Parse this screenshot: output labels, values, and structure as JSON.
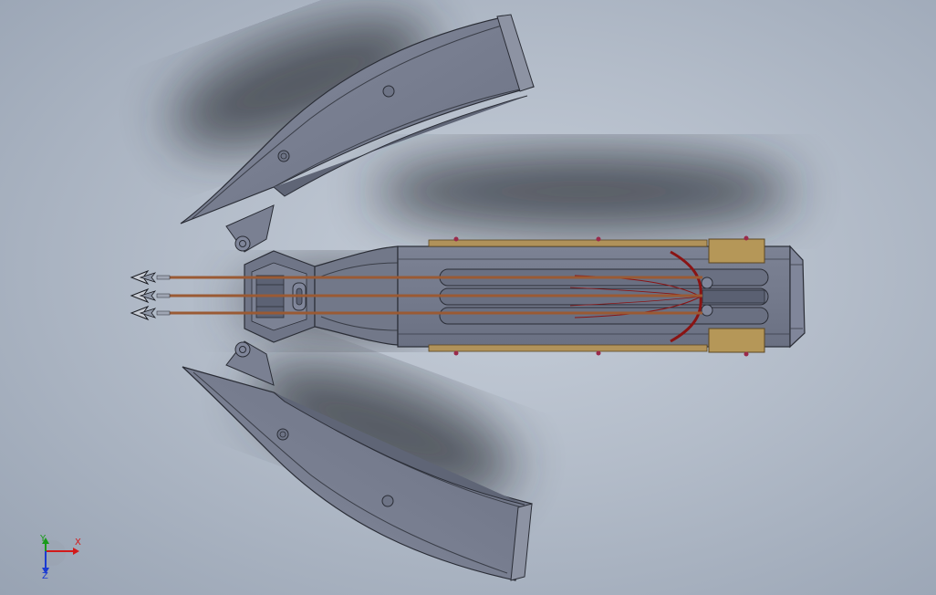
{
  "viewport": {
    "background_top": "#c6ced9",
    "background_bottom": "#98a3b3"
  },
  "model": {
    "body_color": "#747a8c",
    "edge_color": "#2a2d36",
    "rail_color": "#b0925a",
    "bolt_color": "#9a5a34",
    "string_color": "#8a1414",
    "bolt_count": 3
  },
  "triad": {
    "x_label": "X",
    "y_label": "Y",
    "z_label": "Z",
    "x_color": "#d21a1a",
    "y_color": "#1a9a1a",
    "z_color": "#1a3ad2"
  }
}
